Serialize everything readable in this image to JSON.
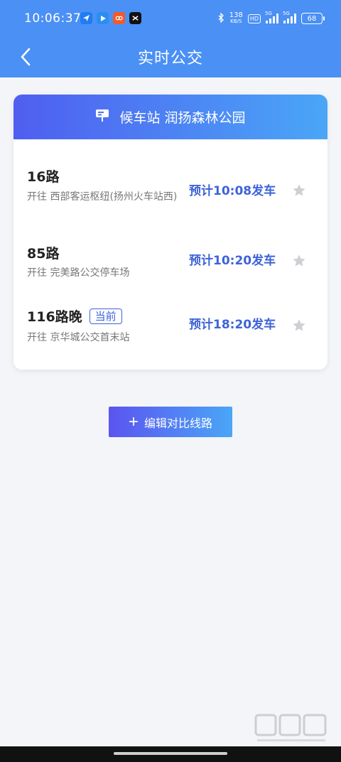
{
  "status_bar": {
    "time": "10:06:37",
    "net_speed_value": "138",
    "net_speed_unit": "KB/S",
    "hd_label": "HD",
    "signal_tag_1": "5G",
    "signal_tag_2": "5G",
    "battery_level": "68"
  },
  "title_bar": {
    "title": "实时公交",
    "back_icon": "chevron-left-icon"
  },
  "station": {
    "label": "候车站",
    "name": "润扬森林公园",
    "icon": "bus-stop-sign-icon"
  },
  "routes": [
    {
      "name": "16路",
      "destination": "开往 西部客运枢纽(扬州火车站西)",
      "eta": "预计10:08发车",
      "current_tag": ""
    },
    {
      "name": "85路",
      "destination": "开往 完美路公交停车场",
      "eta": "预计10:20发车",
      "current_tag": ""
    },
    {
      "name": "116路晚",
      "destination": "开往 京华城公交首末站",
      "eta": "预计18:20发车",
      "current_tag": "当前"
    }
  ],
  "edit_button": {
    "label": "编辑对比线路",
    "icon": "plus-icon"
  },
  "colors": {
    "header_blue": "#4a90f5",
    "eta_blue": "#3e63d8",
    "star_gray": "#cfcfd4",
    "gradient_start": "#4f5ef0",
    "gradient_end": "#4aa6f7"
  }
}
